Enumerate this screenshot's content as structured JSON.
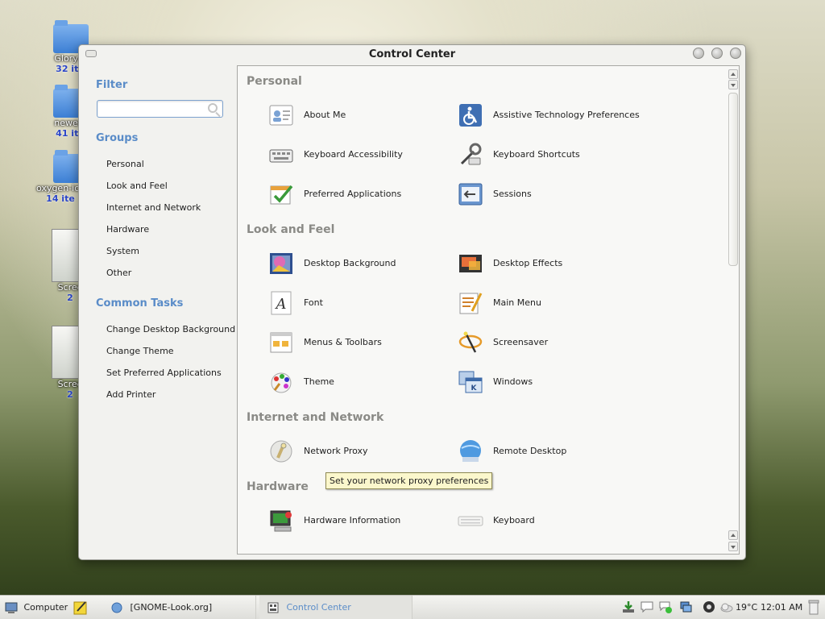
{
  "desktop": {
    "icons": [
      {
        "label": "Glory-L",
        "sub": "32 ite"
      },
      {
        "label": "newest",
        "sub": "41 ite"
      },
      {
        "label": "oxygen-ico",
        "sub": "14 ite"
      },
      {
        "label": "Scree",
        "sub": "2"
      },
      {
        "label": "Scree",
        "sub": "2"
      }
    ]
  },
  "window": {
    "title": "Control Center",
    "buttons": {
      "minimize": "-",
      "maximize": "+",
      "close": "x"
    }
  },
  "sidebar": {
    "filter_heading": "Filter",
    "search": {
      "value": "",
      "placeholder": ""
    },
    "groups_heading": "Groups",
    "groups": [
      "Personal",
      "Look and Feel",
      "Internet and Network",
      "Hardware",
      "System",
      "Other"
    ],
    "tasks_heading": "Common Tasks",
    "tasks": [
      "Change Desktop Background",
      "Change Theme",
      "Set Preferred Applications",
      "Add Printer"
    ]
  },
  "sections": [
    {
      "title": "Personal",
      "items": [
        {
          "label": "About Me",
          "icon": "about-me-icon"
        },
        {
          "label": "Assistive Technology Preferences",
          "icon": "accessibility-icon"
        },
        {
          "label": "Keyboard Accessibility",
          "icon": "keyboard-accessibility-icon"
        },
        {
          "label": "Keyboard Shortcuts",
          "icon": "keyboard-shortcuts-icon"
        },
        {
          "label": "Preferred Applications",
          "icon": "preferred-applications-icon"
        },
        {
          "label": "Sessions",
          "icon": "sessions-icon"
        }
      ]
    },
    {
      "title": "Look and Feel",
      "items": [
        {
          "label": "Desktop Background",
          "icon": "desktop-background-icon"
        },
        {
          "label": "Desktop Effects",
          "icon": "desktop-effects-icon"
        },
        {
          "label": "Font",
          "icon": "font-icon"
        },
        {
          "label": "Main Menu",
          "icon": "main-menu-icon"
        },
        {
          "label": "Menus & Toolbars",
          "icon": "menus-toolbars-icon"
        },
        {
          "label": "Screensaver",
          "icon": "screensaver-icon"
        },
        {
          "label": "Theme",
          "icon": "theme-icon"
        },
        {
          "label": "Windows",
          "icon": "windows-icon"
        }
      ]
    },
    {
      "title": "Internet and Network",
      "items": [
        {
          "label": "Network Proxy",
          "icon": "network-proxy-icon"
        },
        {
          "label": "Remote Desktop",
          "icon": "remote-desktop-icon"
        }
      ]
    },
    {
      "title": "Hardware",
      "items": [
        {
          "label": "Hardware Information",
          "icon": "hardware-information-icon"
        },
        {
          "label": "Keyboard",
          "icon": "keyboard-icon"
        }
      ]
    }
  ],
  "tooltip": "Set your network proxy preferences",
  "taskbar": {
    "computer": "Computer",
    "tasks": [
      "[GNOME-Look.org]",
      "Control Center"
    ],
    "temperature": "19°C",
    "clock": "12:01 AM"
  },
  "colors": {
    "accent": "#5a8cc8",
    "section_heading": "#8a8a86",
    "tooltip_bg": "#fbf7cc"
  }
}
